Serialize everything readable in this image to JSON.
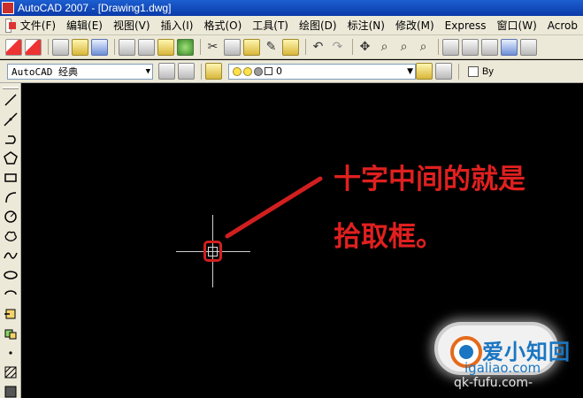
{
  "window": {
    "title": "AutoCAD 2007 - [Drawing1.dwg]"
  },
  "menu": {
    "items": [
      {
        "label": "文件(F)"
      },
      {
        "label": "编辑(E)"
      },
      {
        "label": "视图(V)"
      },
      {
        "label": "插入(I)"
      },
      {
        "label": "格式(O)"
      },
      {
        "label": "工具(T)"
      },
      {
        "label": "绘图(D)"
      },
      {
        "label": "标注(N)"
      },
      {
        "label": "修改(M)"
      },
      {
        "label": "Express"
      },
      {
        "label": "窗口(W)"
      },
      {
        "label": "Acrob"
      }
    ]
  },
  "toolbar2": {
    "workspace_value": "AutoCAD 经典",
    "layer_value": "0",
    "bylayer_label": "By"
  },
  "annotation": {
    "line1": "十字中间的就是",
    "line2": "拾取框。",
    "color": "#e0201f"
  },
  "watermark": {
    "name": "爱小知回",
    "url": "igaliao.com",
    "sub": "qk-fufu.com-"
  },
  "colors": {
    "canvas": "#000000",
    "chrome": "#ece9d8",
    "titlebar": "#0b3aa8",
    "highlight": "#d11f1f"
  }
}
